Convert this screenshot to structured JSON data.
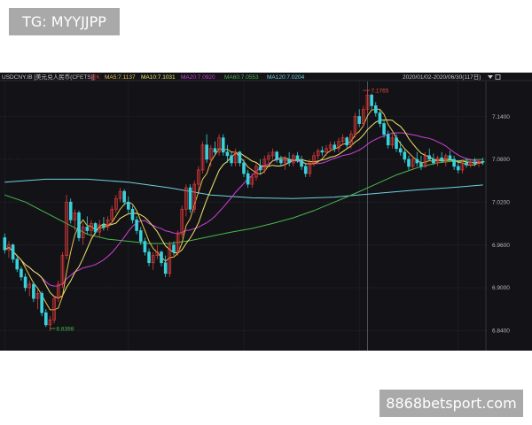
{
  "watermarks": {
    "top": "TG: MYYJJPP",
    "bottom": "8868betsport.com"
  },
  "header": {
    "symbol": "USDCNY.IB [美元兑人民币(CFETS)]",
    "candle_label": "日K",
    "indicators": [
      {
        "label": "MA5:7.1137",
        "color": "#e8c14a"
      },
      {
        "label": "MA10:7.1031",
        "color": "#f2e56b"
      },
      {
        "label": "MA20:7.0920",
        "color": "#cf3fd9"
      },
      {
        "label": "MA60:7.0553",
        "color": "#49b84a"
      },
      {
        "label": "MA120:7.0204",
        "color": "#6fd0e0"
      }
    ],
    "range": "2020/01/02-2020/06/30(117日)"
  },
  "colors": {
    "up": "#e03a3a",
    "down": "#39d2dc",
    "grid": "#2a2f3a",
    "axis_text": "#b9b9b9"
  },
  "chart_data": {
    "type": "candlestick",
    "ylim": [
      6.82,
      7.2
    ],
    "y_ticks": [
      "7.1400",
      "7.0800",
      "7.0200",
      "6.9600",
      "6.9000",
      "6.8400"
    ],
    "max_annotation": {
      "index": 88,
      "value": 7.1765,
      "label": "7.1765"
    },
    "min_annotation": {
      "index": 11,
      "value": 6.8398,
      "label": "6.8398"
    },
    "candles": [
      [
        6.9701,
        6.976,
        6.948,
        6.953
      ],
      [
        6.953,
        6.965,
        6.942,
        6.96
      ],
      [
        6.96,
        6.962,
        6.935,
        6.94
      ],
      [
        6.94,
        6.945,
        6.922,
        6.926
      ],
      [
        6.926,
        6.93,
        6.91,
        6.915
      ],
      [
        6.915,
        6.92,
        6.895,
        6.9
      ],
      [
        6.9,
        6.91,
        6.888,
        6.905
      ],
      [
        6.905,
        6.908,
        6.88,
        6.885
      ],
      [
        6.885,
        6.898,
        6.87,
        6.892
      ],
      [
        6.892,
        6.895,
        6.86,
        6.865
      ],
      [
        6.865,
        6.87,
        6.845,
        6.848
      ],
      [
        6.848,
        6.86,
        6.8398,
        6.855
      ],
      [
        6.855,
        6.888,
        6.85,
        6.885
      ],
      [
        6.885,
        6.91,
        6.88,
        6.905
      ],
      [
        6.905,
        6.95,
        6.9,
        6.945
      ],
      [
        6.945,
        7.03,
        6.94,
        7.02
      ],
      [
        7.02,
        7.025,
        6.99,
        6.995
      ],
      [
        6.995,
        7.01,
        6.98,
        7.005
      ],
      [
        7.005,
        7.008,
        6.965,
        6.97
      ],
      [
        6.97,
        6.99,
        6.96,
        6.985
      ],
      [
        6.985,
        7.0,
        6.975,
        6.98
      ],
      [
        6.98,
        6.995,
        6.97,
        6.99
      ],
      [
        6.99,
        6.992,
        6.975,
        6.978
      ],
      [
        6.978,
        6.995,
        6.97,
        6.988
      ],
      [
        6.988,
        6.999,
        6.98,
        6.985
      ],
      [
        6.985,
        7.0,
        6.98,
        6.995
      ],
      [
        6.995,
        7.015,
        6.99,
        7.01
      ],
      [
        7.01,
        7.03,
        7.005,
        7.025
      ],
      [
        7.025,
        7.04,
        7.02,
        7.035
      ],
      [
        7.035,
        7.038,
        7.015,
        7.02
      ],
      [
        7.02,
        7.028,
        7.005,
        7.01
      ],
      [
        7.01,
        7.015,
        6.99,
        6.995
      ],
      [
        6.995,
        7.0,
        6.975,
        6.98
      ],
      [
        6.98,
        6.985,
        6.96,
        6.965
      ],
      [
        6.965,
        6.97,
        6.945,
        6.95
      ],
      [
        6.95,
        6.955,
        6.93,
        6.935
      ],
      [
        6.935,
        6.95,
        6.925,
        6.945
      ],
      [
        6.945,
        6.96,
        6.94,
        6.95
      ],
      [
        6.95,
        6.952,
        6.93,
        6.935
      ],
      [
        6.935,
        6.945,
        6.915,
        6.92
      ],
      [
        6.92,
        6.965,
        6.915,
        6.96
      ],
      [
        6.96,
        6.965,
        6.945,
        6.95
      ],
      [
        6.95,
        6.98,
        6.945,
        6.975
      ],
      [
        6.975,
        7.015,
        6.97,
        7.01
      ],
      [
        7.01,
        7.045,
        7.0,
        7.04
      ],
      [
        7.04,
        7.045,
        7.005,
        7.01
      ],
      [
        7.01,
        7.05,
        7.005,
        7.045
      ],
      [
        7.045,
        7.07,
        7.035,
        7.065
      ],
      [
        7.065,
        7.105,
        7.06,
        7.1
      ],
      [
        7.1,
        7.115,
        7.075,
        7.08
      ],
      [
        7.08,
        7.1,
        7.07,
        7.095
      ],
      [
        7.095,
        7.105,
        7.085,
        7.09
      ],
      [
        7.09,
        7.115,
        7.085,
        7.11
      ],
      [
        7.11,
        7.115,
        7.085,
        7.09
      ],
      [
        7.09,
        7.1,
        7.075,
        7.085
      ],
      [
        7.085,
        7.09,
        7.07,
        7.075
      ],
      [
        7.075,
        7.095,
        7.07,
        7.09
      ],
      [
        7.09,
        7.092,
        7.07,
        7.075
      ],
      [
        7.075,
        7.08,
        7.055,
        7.06
      ],
      [
        7.06,
        7.065,
        7.04,
        7.045
      ],
      [
        7.045,
        7.06,
        7.04,
        7.055
      ],
      [
        7.055,
        7.075,
        7.05,
        7.07
      ],
      [
        7.07,
        7.08,
        7.06,
        7.065
      ],
      [
        7.065,
        7.085,
        7.06,
        7.08
      ],
      [
        7.08,
        7.09,
        7.075,
        7.085
      ],
      [
        7.085,
        7.095,
        7.08,
        7.09
      ],
      [
        7.09,
        7.092,
        7.075,
        7.08
      ],
      [
        7.08,
        7.085,
        7.07,
        7.075
      ],
      [
        7.075,
        7.085,
        7.065,
        7.08
      ],
      [
        7.08,
        7.09,
        7.07,
        7.075
      ],
      [
        7.075,
        7.088,
        7.07,
        7.085
      ],
      [
        7.085,
        7.09,
        7.075,
        7.078
      ],
      [
        7.078,
        7.085,
        7.065,
        7.07
      ],
      [
        7.07,
        7.075,
        7.055,
        7.06
      ],
      [
        7.06,
        7.08,
        7.055,
        7.075
      ],
      [
        7.075,
        7.09,
        7.07,
        7.085
      ],
      [
        7.085,
        7.095,
        7.08,
        7.092
      ],
      [
        7.092,
        7.098,
        7.085,
        7.09
      ],
      [
        7.09,
        7.1,
        7.085,
        7.095
      ],
      [
        7.095,
        7.105,
        7.09,
        7.1
      ],
      [
        7.1,
        7.105,
        7.09,
        7.095
      ],
      [
        7.095,
        7.11,
        7.09,
        7.105
      ],
      [
        7.105,
        7.115,
        7.1,
        7.11
      ],
      [
        7.11,
        7.112,
        7.095,
        7.1
      ],
      [
        7.1,
        7.12,
        7.095,
        7.115
      ],
      [
        7.115,
        7.145,
        7.11,
        7.14
      ],
      [
        7.14,
        7.15,
        7.125,
        7.13
      ],
      [
        7.13,
        7.155,
        7.125,
        7.15
      ],
      [
        7.15,
        7.1765,
        7.145,
        7.17
      ],
      [
        7.17,
        7.172,
        7.15,
        7.155
      ],
      [
        7.155,
        7.16,
        7.14,
        7.145
      ],
      [
        7.145,
        7.15,
        7.125,
        7.13
      ],
      [
        7.13,
        7.135,
        7.11,
        7.115
      ],
      [
        7.115,
        7.12,
        7.095,
        7.1
      ],
      [
        7.1,
        7.115,
        7.095,
        7.11
      ],
      [
        7.11,
        7.115,
        7.09,
        7.095
      ],
      [
        7.095,
        7.105,
        7.085,
        7.09
      ],
      [
        7.09,
        7.095,
        7.075,
        7.08
      ],
      [
        7.08,
        7.085,
        7.065,
        7.07
      ],
      [
        7.07,
        7.085,
        7.065,
        7.08
      ],
      [
        7.08,
        7.09,
        7.07,
        7.075
      ],
      [
        7.075,
        7.085,
        7.065,
        7.07
      ],
      [
        7.07,
        7.09,
        7.068,
        7.085
      ],
      [
        7.085,
        7.095,
        7.078,
        7.08
      ],
      [
        7.08,
        7.088,
        7.072,
        7.075
      ],
      [
        7.075,
        7.085,
        7.07,
        7.082
      ],
      [
        7.082,
        7.09,
        7.075,
        7.078
      ],
      [
        7.078,
        7.088,
        7.07,
        7.085
      ],
      [
        7.085,
        7.092,
        7.078,
        7.08
      ],
      [
        7.08,
        7.085,
        7.065,
        7.07
      ],
      [
        7.07,
        7.078,
        7.06,
        7.065
      ],
      [
        7.065,
        7.08,
        7.06,
        7.075
      ],
      [
        7.075,
        7.082,
        7.068,
        7.072
      ],
      [
        7.072,
        7.08,
        7.068,
        7.076
      ],
      [
        7.076,
        7.082,
        7.07,
        7.074
      ],
      [
        7.074,
        7.08,
        7.069,
        7.077
      ],
      [
        7.077,
        7.082,
        7.072,
        7.076
      ]
    ],
    "ma60": [
      [
        0,
        7.03
      ],
      [
        5,
        7.02
      ],
      [
        10,
        7.005
      ],
      [
        15,
        6.99
      ],
      [
        20,
        6.975
      ],
      [
        25,
        6.968
      ],
      [
        30,
        6.965
      ],
      [
        35,
        6.962
      ],
      [
        40,
        6.962
      ],
      [
        45,
        6.966
      ],
      [
        50,
        6.972
      ],
      [
        55,
        6.978
      ],
      [
        60,
        6.983
      ],
      [
        65,
        6.99
      ],
      [
        70,
        6.998
      ],
      [
        75,
        7.008
      ],
      [
        80,
        7.02
      ],
      [
        85,
        7.032
      ],
      [
        90,
        7.045
      ],
      [
        95,
        7.058
      ],
      [
        100,
        7.068
      ],
      [
        105,
        7.075
      ],
      [
        110,
        7.078
      ],
      [
        116,
        7.08
      ]
    ],
    "ma120": [
      [
        0,
        7.048
      ],
      [
        10,
        7.052
      ],
      [
        20,
        7.052
      ],
      [
        30,
        7.048
      ],
      [
        40,
        7.04
      ],
      [
        50,
        7.03
      ],
      [
        60,
        7.026
      ],
      [
        70,
        7.025
      ],
      [
        80,
        7.027
      ],
      [
        90,
        7.032
      ],
      [
        100,
        7.037
      ],
      [
        110,
        7.041
      ],
      [
        116,
        7.044
      ]
    ]
  }
}
